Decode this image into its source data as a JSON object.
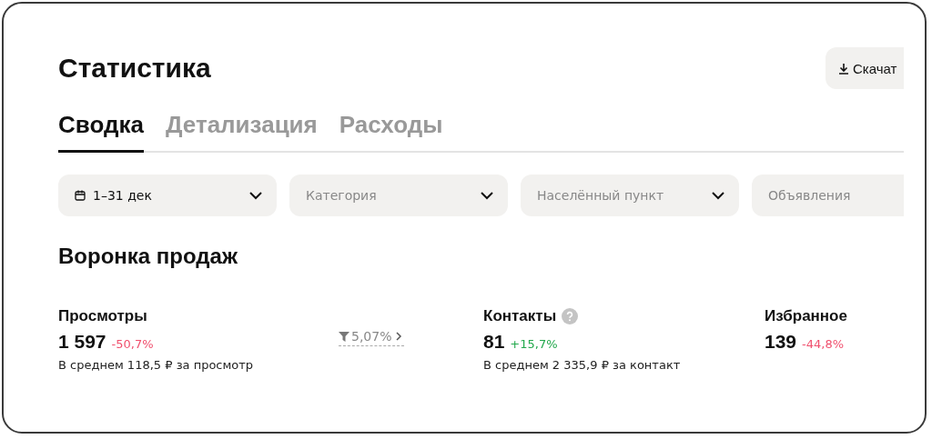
{
  "page": {
    "title": "Статистика",
    "download_button": "Скачат"
  },
  "tabs": [
    {
      "label": "Сводка",
      "selected": true
    },
    {
      "label": "Детализация",
      "selected": false
    },
    {
      "label": "Расходы",
      "selected": false
    }
  ],
  "filters": [
    {
      "kind": "date",
      "value": "1–31 дек",
      "chevron": true
    },
    {
      "kind": "select",
      "placeholder": "Категория",
      "chevron": true
    },
    {
      "kind": "select",
      "placeholder": "Населённый пункт",
      "chevron": true
    },
    {
      "kind": "select",
      "placeholder": "Объявления",
      "chevron": false
    }
  ],
  "funnel": {
    "title": "Воронка продаж",
    "conversion": "5,07%",
    "metrics": [
      {
        "label": "Просмотры",
        "help": false,
        "value": "1 597",
        "change": "-50,7%",
        "color": "#f0506e",
        "note": "В среднем 118,5 ₽ за просмотр"
      },
      {
        "label": "Контакты",
        "help": true,
        "value": "81",
        "change": "+15,7%",
        "color": "#22a84c",
        "note": "В среднем 2 335,9 ₽ за контакт"
      },
      {
        "label": "Избранное",
        "help": false,
        "value": "139",
        "change": "-44,8%",
        "color": "#f0506e"
      }
    ]
  }
}
